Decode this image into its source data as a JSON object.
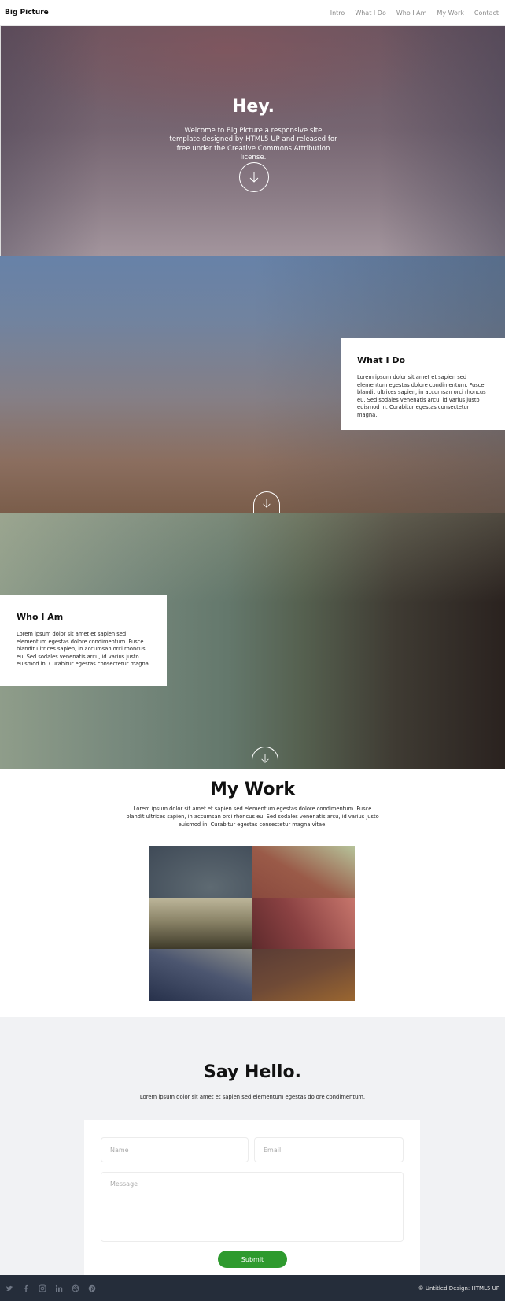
{
  "header": {
    "logo": "Big Picture",
    "nav": [
      "Intro",
      "What I Do",
      "Who I Am",
      "My Work",
      "Contact"
    ]
  },
  "intro": {
    "title": "Hey.",
    "text": "Welcome to Big Picture a responsive site template designed by HTML5 UP and released for free under the Creative Commons Attribution license."
  },
  "what_i_do": {
    "title": "What I Do",
    "text": "Lorem ipsum dolor sit amet et sapien sed elementum egestas dolore condimentum. Fusce blandit ultrices sapien, in accumsan orci rhoncus eu. Sed sodales venenatis arcu, id varius justo euismod in. Curabitur egestas consectetur magna."
  },
  "who_i_am": {
    "title": "Who I Am",
    "text": "Lorem ipsum dolor sit amet et sapien sed elementum egestas dolore condimentum. Fusce blandit ultrices sapien, in accumsan orci rhoncus eu. Sed sodales venenatis arcu, id varius justo euismod in. Curabitur egestas consectetur magna."
  },
  "my_work": {
    "title": "My Work",
    "text": "Lorem ipsum dolor sit amet et sapien sed elementum egestas dolore condimentum. Fusce blandit ultrices sapien, in accumsan orci rhoncus eu. Sed sodales venenatis arcu, id varius justo euismod in. Curabitur egestas consectetur magna vitae."
  },
  "contact": {
    "title": "Say Hello.",
    "text": "Lorem ipsum dolor sit amet et sapien sed elementum egestas dolore condimentum.",
    "name_placeholder": "Name",
    "email_placeholder": "Email",
    "message_placeholder": "Message",
    "submit_label": "Submit"
  },
  "footer": {
    "copyright": "© Untitled Design: HTML5 UP",
    "icons": [
      "twitter-icon",
      "facebook-icon",
      "instagram-icon",
      "linkedin-icon",
      "dribbble-icon",
      "pinterest-icon"
    ]
  },
  "colors": {
    "accent": "#2e9a2e",
    "footer_bg": "#252d3a",
    "contact_bg": "#f1f2f4"
  }
}
